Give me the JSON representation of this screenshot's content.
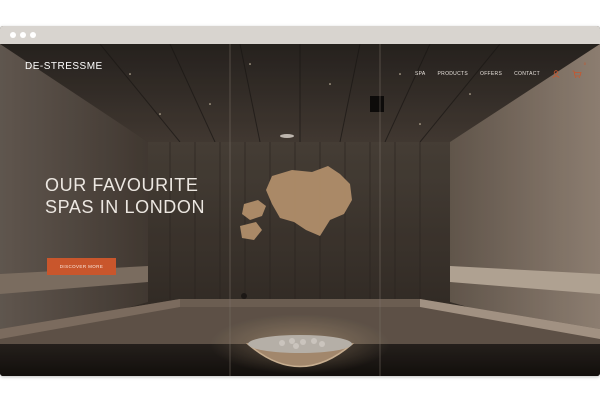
{
  "browser": {
    "dots": 3
  },
  "site": {
    "logo": "DE-STRESSME"
  },
  "nav": [
    {
      "label": "SPA"
    },
    {
      "label": "PRODUCTS"
    },
    {
      "label": "OFFERS"
    },
    {
      "label": "CONTACT"
    }
  ],
  "header_icons": {
    "user": "user-icon",
    "cart": "cart-icon",
    "cart_count": "0"
  },
  "hero": {
    "headline_line1": "OUR FAVOURITE",
    "headline_line2": "SPAS IN LONDON",
    "cta_label": "DISCOVER MORE"
  },
  "colors": {
    "accent": "#c9562c",
    "text": "#ece7e1",
    "frame": "#d8d4cf"
  }
}
